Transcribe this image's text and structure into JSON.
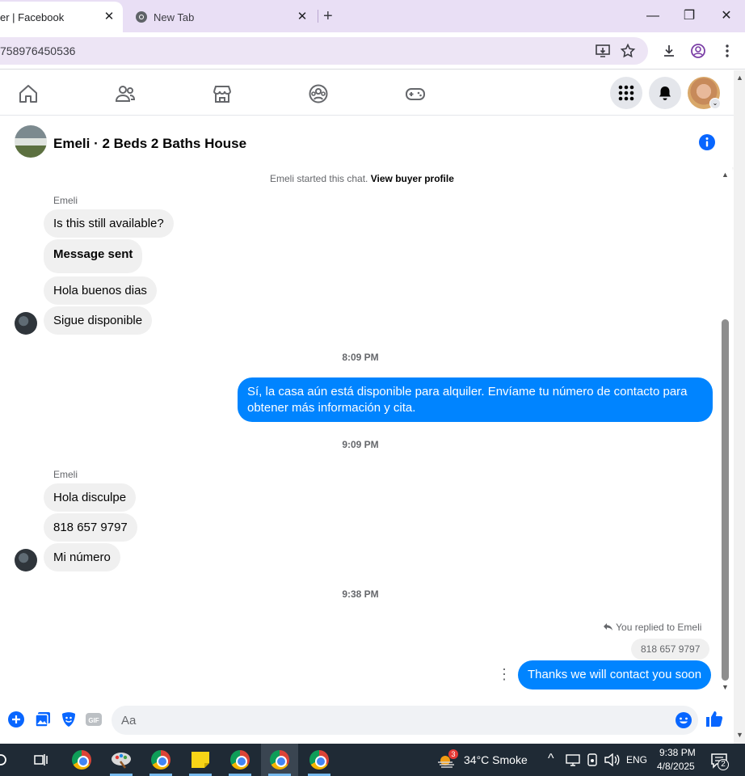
{
  "browser": {
    "tabs": [
      {
        "title": "er | Facebook",
        "active": true
      },
      {
        "title": "New Tab",
        "active": false
      }
    ],
    "url": "758976450536"
  },
  "chat": {
    "title": "Emeli · 2 Beds 2 Baths House",
    "system_note": "Emeli started this chat.",
    "view_profile_link": "View buyer profile",
    "groups": [
      {
        "sender": "Emeli",
        "messages": [
          "Is this still available?",
          "Message sent",
          "Hola buenos dias",
          "Sigue disponible"
        ]
      },
      {
        "timestamp": "8:09 PM"
      },
      {
        "outgoing": "Sí, la casa aún está disponible para alquiler. Envíame tu número de contacto para obtener más información y cita."
      },
      {
        "timestamp": "9:09 PM"
      },
      {
        "sender": "Emeli",
        "messages": [
          "Hola disculpe",
          "818 657 9797",
          "Mi número"
        ]
      },
      {
        "timestamp": "9:38 PM"
      },
      {
        "reply_note": "You replied to Emeli",
        "quoted": "818 657 9797",
        "outgoing": "Thanks we will contact you soon"
      }
    ],
    "composer_placeholder": "Aa",
    "accent_color": "#0084ff"
  },
  "taskbar": {
    "weather_badge": "3",
    "weather": "34°C  Smoke",
    "language": "ENG",
    "time": "9:38 PM",
    "date": "4/8/2025",
    "notification_count": "2"
  }
}
